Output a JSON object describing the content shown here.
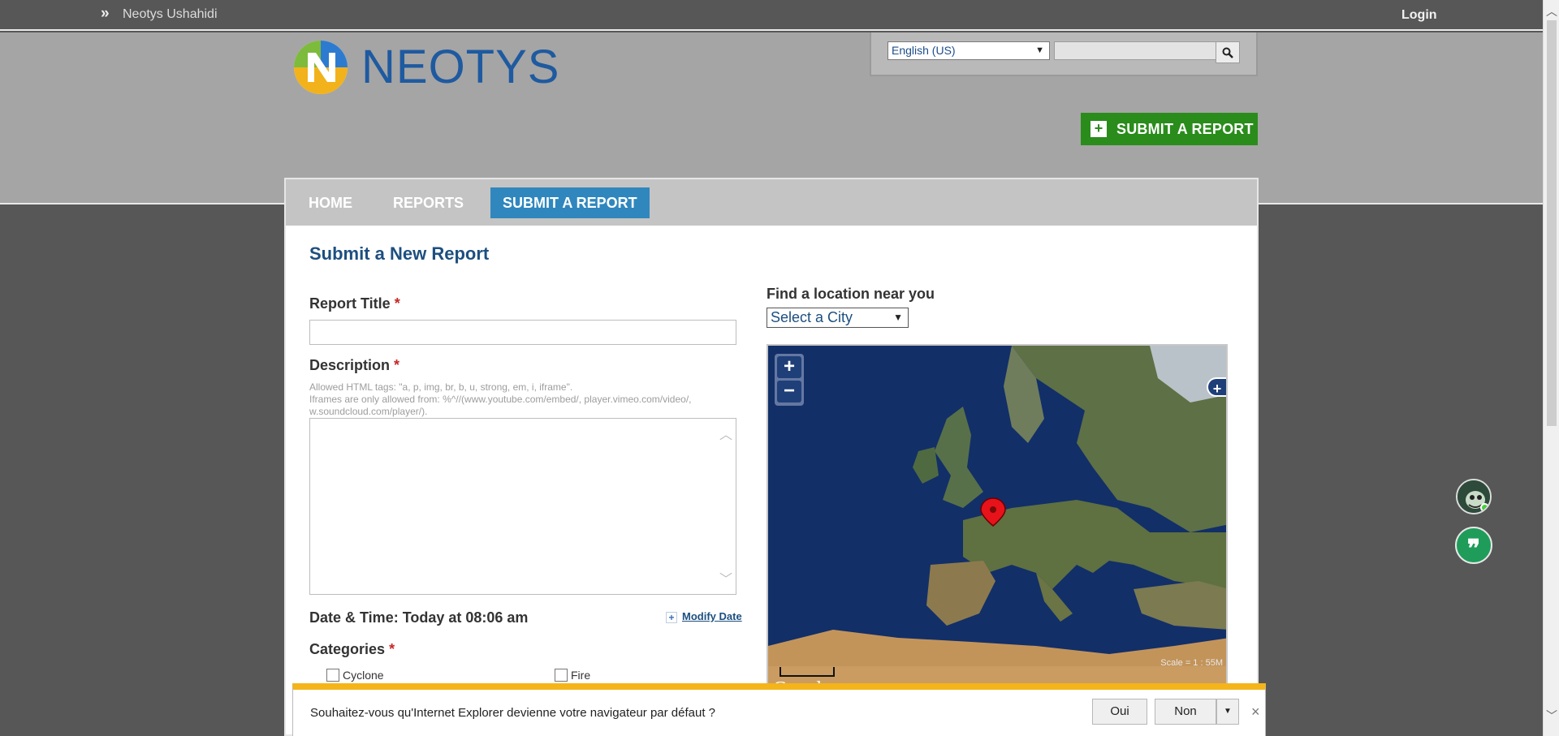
{
  "topbar": {
    "chevron": "»",
    "site_name": "Neotys Ushahidi",
    "login": "Login"
  },
  "logo": {
    "word": "NEOTYS"
  },
  "search": {
    "language": "English (US)",
    "placeholder": "",
    "button_icon": "search-icon"
  },
  "header": {
    "submit_button": "SUBMIT A REPORT"
  },
  "nav": {
    "items": [
      "HOME",
      "REPORTS",
      "SUBMIT A REPORT"
    ],
    "active": "SUBMIT A REPORT"
  },
  "form": {
    "title": "Submit a New Report",
    "report_title_label": "Report Title",
    "required_mark": "*",
    "description_label": "Description",
    "description_hint_1": "Allowed HTML tags: \"a, p, img, br, b, u, strong, em, i, iframe\".",
    "description_hint_2": "Iframes are only allowed from: %^//(www.youtube.com/embed/, player.vimeo.com/video/, w.soundcloud.com/player/).",
    "datetime": "Date & Time: Today at 08:06 am",
    "modify_date": "Modify Date",
    "categories_label": "Categories",
    "categories": [
      "Cyclone",
      "Fire"
    ]
  },
  "location": {
    "label": "Find a location near you",
    "city_select": "Select a City",
    "map": {
      "zoom_in": "+",
      "zoom_out": "−",
      "layer_switch": "+",
      "scale": "Scale = 1 : 55M",
      "attribution": "Google"
    }
  },
  "ie_bar": {
    "message": "Souhaitez-vous qu'Internet Explorer devienne votre navigateur par défaut ?",
    "yes": "Oui",
    "no": "Non",
    "close": "×"
  },
  "colors": {
    "accent_blue": "#2f87be",
    "submit_green": "#2a8c1b",
    "ie_bar_yellow": "#f4b41a"
  }
}
